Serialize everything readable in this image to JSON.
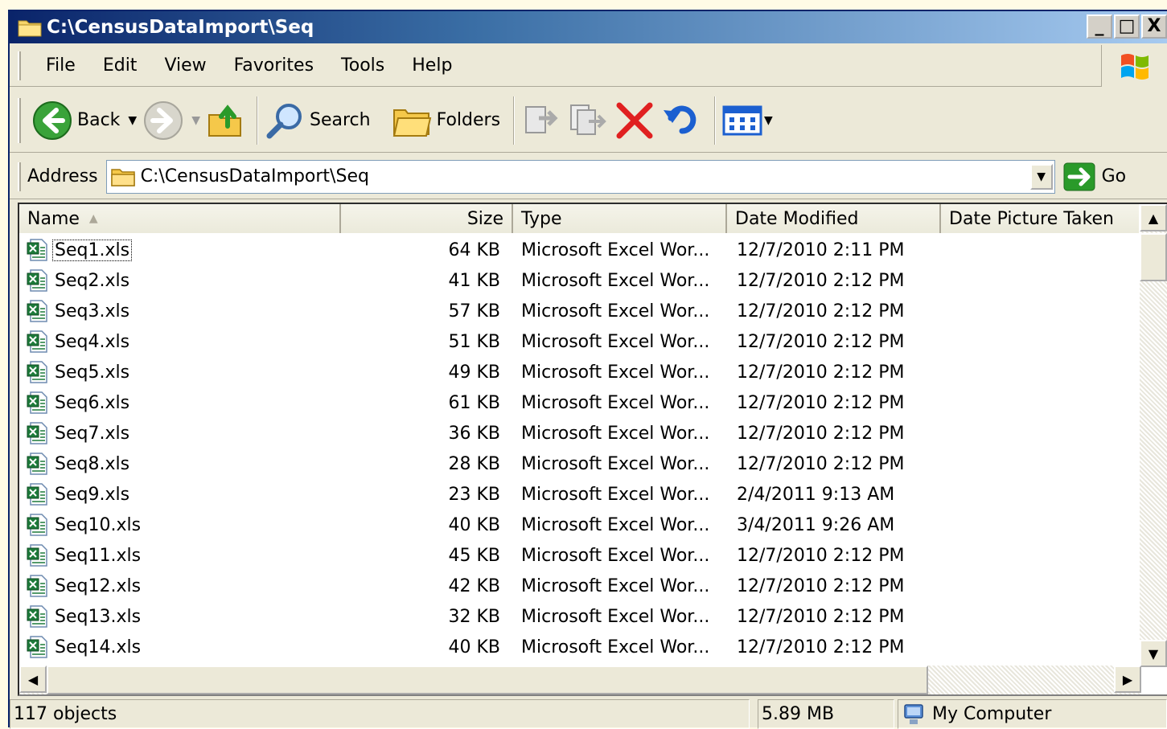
{
  "window": {
    "title": "C:\\CensusDataImport\\Seq",
    "min_label": "_",
    "max_label": "□",
    "close_label": "X"
  },
  "menu": [
    "File",
    "Edit",
    "View",
    "Favorites",
    "Tools",
    "Help"
  ],
  "toolbar": {
    "back_label": "Back",
    "search_label": "Search",
    "folders_label": "Folders"
  },
  "address": {
    "label": "Address",
    "value": "C:\\CensusDataImport\\Seq",
    "go_label": "Go"
  },
  "columns": {
    "name": "Name",
    "size": "Size",
    "type": "Type",
    "date_modified": "Date Modified",
    "date_picture": "Date Picture Taken"
  },
  "files": [
    {
      "name": "Seq1.xls",
      "size": "64 KB",
      "type": "Microsoft Excel Wor...",
      "date": "12/7/2010 2:11 PM"
    },
    {
      "name": "Seq2.xls",
      "size": "41 KB",
      "type": "Microsoft Excel Wor...",
      "date": "12/7/2010 2:12 PM"
    },
    {
      "name": "Seq3.xls",
      "size": "57 KB",
      "type": "Microsoft Excel Wor...",
      "date": "12/7/2010 2:12 PM"
    },
    {
      "name": "Seq4.xls",
      "size": "51 KB",
      "type": "Microsoft Excel Wor...",
      "date": "12/7/2010 2:12 PM"
    },
    {
      "name": "Seq5.xls",
      "size": "49 KB",
      "type": "Microsoft Excel Wor...",
      "date": "12/7/2010 2:12 PM"
    },
    {
      "name": "Seq6.xls",
      "size": "61 KB",
      "type": "Microsoft Excel Wor...",
      "date": "12/7/2010 2:12 PM"
    },
    {
      "name": "Seq7.xls",
      "size": "36 KB",
      "type": "Microsoft Excel Wor...",
      "date": "12/7/2010 2:12 PM"
    },
    {
      "name": "Seq8.xls",
      "size": "28 KB",
      "type": "Microsoft Excel Wor...",
      "date": "12/7/2010 2:12 PM"
    },
    {
      "name": "Seq9.xls",
      "size": "23 KB",
      "type": "Microsoft Excel Wor...",
      "date": "2/4/2011 9:13 AM"
    },
    {
      "name": "Seq10.xls",
      "size": "40 KB",
      "type": "Microsoft Excel Wor...",
      "date": "3/4/2011 9:26 AM"
    },
    {
      "name": "Seq11.xls",
      "size": "45 KB",
      "type": "Microsoft Excel Wor...",
      "date": "12/7/2010 2:12 PM"
    },
    {
      "name": "Seq12.xls",
      "size": "42 KB",
      "type": "Microsoft Excel Wor...",
      "date": "12/7/2010 2:12 PM"
    },
    {
      "name": "Seq13.xls",
      "size": "32 KB",
      "type": "Microsoft Excel Wor...",
      "date": "12/7/2010 2:12 PM"
    },
    {
      "name": "Seq14.xls",
      "size": "40 KB",
      "type": "Microsoft Excel Wor...",
      "date": "12/7/2010 2:12 PM"
    }
  ],
  "status": {
    "objects": "117 objects",
    "size": "5.89 MB",
    "location": "My Computer"
  },
  "colors": {
    "title_bar": "#0a246a",
    "excel_green": "#1d7a3a",
    "delete_red": "#e02020"
  }
}
